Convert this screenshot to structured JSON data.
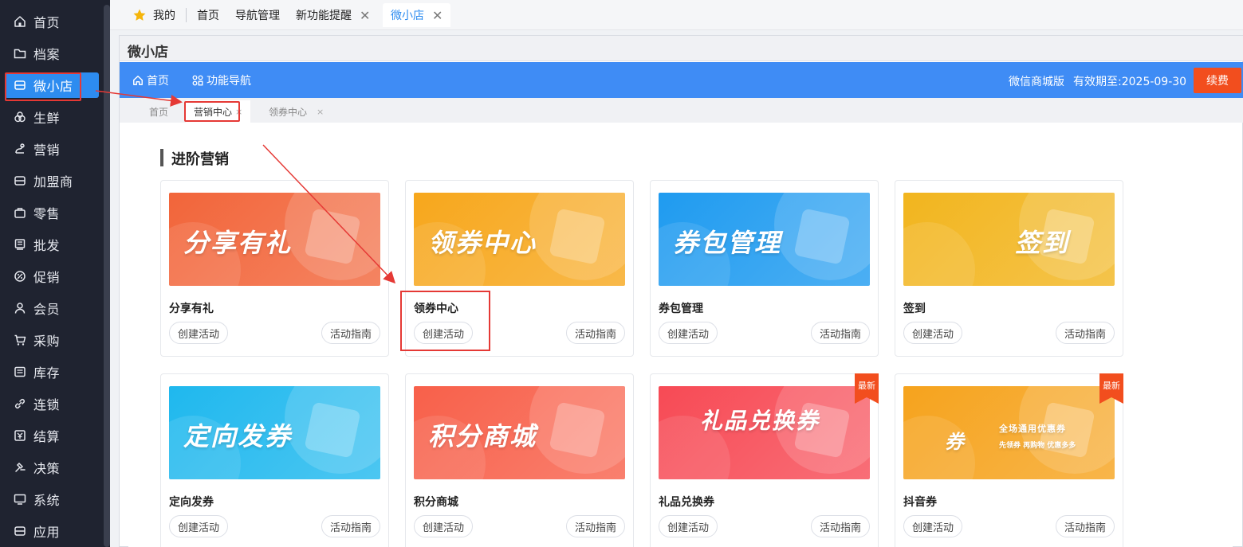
{
  "sidebar": {
    "items": [
      {
        "label": "首页",
        "icon": "home-icon"
      },
      {
        "label": "档案",
        "icon": "folder-icon"
      },
      {
        "label": "微小店",
        "icon": "shop-icon"
      },
      {
        "label": "生鲜",
        "icon": "fruit-icon"
      },
      {
        "label": "营销",
        "icon": "marketing-icon"
      },
      {
        "label": "加盟商",
        "icon": "franchise-icon"
      },
      {
        "label": "零售",
        "icon": "retail-icon"
      },
      {
        "label": "批发",
        "icon": "wholesale-icon"
      },
      {
        "label": "促销",
        "icon": "promotion-icon"
      },
      {
        "label": "会员",
        "icon": "user-icon"
      },
      {
        "label": "采购",
        "icon": "cart-icon"
      },
      {
        "label": "库存",
        "icon": "inventory-icon"
      },
      {
        "label": "连锁",
        "icon": "link-icon"
      },
      {
        "label": "结算",
        "icon": "settlement-icon"
      },
      {
        "label": "决策",
        "icon": "decision-icon"
      },
      {
        "label": "系统",
        "icon": "monitor-icon"
      },
      {
        "label": "应用",
        "icon": "app-icon"
      }
    ],
    "active_index": 2
  },
  "top_tabs": {
    "mine": "我的",
    "tabs": [
      {
        "label": "首页"
      },
      {
        "label": "导航管理"
      },
      {
        "label": "新功能提醒"
      },
      {
        "label": "微小店"
      }
    ],
    "close_glyph": "✕"
  },
  "window": {
    "title": "微小店",
    "nav": {
      "home": "首页",
      "guide": "功能导航"
    },
    "edition": "微信商城版",
    "expire": "有效期至:2025-09-30",
    "renew": "续费"
  },
  "sub_tabs": {
    "items": [
      "首页",
      "营销中心",
      "领券中心"
    ],
    "close_glyph": "×"
  },
  "section": {
    "title": "进阶营销"
  },
  "cards": [
    {
      "title": "分享有礼",
      "banner_text": "分享有礼",
      "banner_color": "#f2653a",
      "badge": ""
    },
    {
      "title": "领券中心",
      "banner_text": "领券中心",
      "banner_color": "#f7a71c",
      "badge": ""
    },
    {
      "title": "券包管理",
      "banner_text": "券包管理",
      "banner_color": "#1f9bf0",
      "badge": ""
    },
    {
      "title": "签到",
      "banner_text": "签到",
      "banner_color": "#f2b51e",
      "badge": ""
    },
    {
      "title": "定向发券",
      "banner_text": "定向发券",
      "banner_color": "#1fb8ee",
      "badge": ""
    },
    {
      "title": "积分商城",
      "banner_text": "积分商城",
      "banner_color": "#f8604a",
      "badge": ""
    },
    {
      "title": "礼品兑换券",
      "banner_text": "礼品兑换券",
      "banner_color": "#f74a55",
      "badge": "最新"
    },
    {
      "title": "抖音券",
      "banner_text": "券",
      "banner_subtext": "全场通用优惠券",
      "banner_subtext2": "先领券 再购物 优惠多多",
      "banner_color": "#f6a31d",
      "badge": "最新"
    }
  ],
  "buttons": {
    "create": "创建活动",
    "guide": "活动指南"
  },
  "colors": {
    "accent": "#3f8cf5",
    "sidebar_bg": "#1f2330",
    "highlight": "#e53935",
    "renew": "#f24e1e"
  }
}
